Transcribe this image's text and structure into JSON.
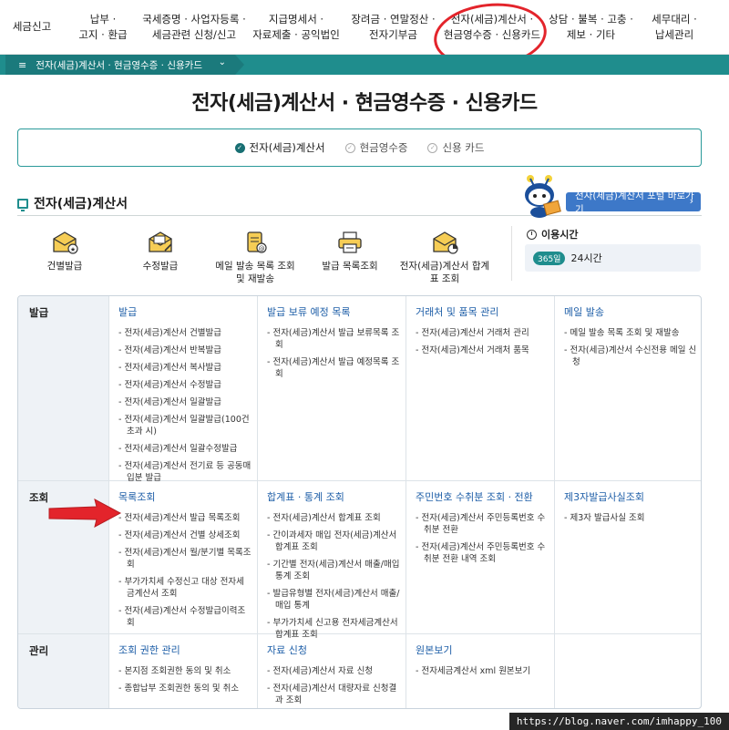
{
  "nav": {
    "items": [
      {
        "line1": "세금신고",
        "line2": ""
      },
      {
        "line1": "납부 ·",
        "line2": "고지 · 환급"
      },
      {
        "line1": "국세증명 · 사업자등록 ·",
        "line2": "세금관련 신청/신고"
      },
      {
        "line1": "지급명세서 ·",
        "line2": "자료제출 · 공익법인"
      },
      {
        "line1": "장려금 · 연말정산 ·",
        "line2": "전자기부금"
      },
      {
        "line1": "전자(세금)계산서 ·",
        "line2": "현금영수증 · 신용카드"
      },
      {
        "line1": "상담 · 불복 · 고충 ·",
        "line2": "제보 · 기타"
      },
      {
        "line1": "세무대리 ·",
        "line2": "납세관리"
      }
    ]
  },
  "breadcrumb": {
    "label": "전자(세금)계산서 · 현금영수증 · 신용카드"
  },
  "page_title": "전자(세금)계산서 · 현금영수증 · 신용카드",
  "tabs": [
    {
      "label": "전자(세금)계산서",
      "active": true
    },
    {
      "label": "현금영수증",
      "active": false
    },
    {
      "label": "신용 카드",
      "active": false
    }
  ],
  "section": {
    "title": "전자(세금)계산서",
    "portal_button": "전자(세금)계산서 포털 바로가기"
  },
  "quick_links": [
    {
      "label": "건별발급",
      "icon": "envelope-star-icon"
    },
    {
      "label": "수정발급",
      "icon": "envelope-edit-icon"
    },
    {
      "label": "메일 발송 목록 조회 및 재발송",
      "icon": "scroll-mail-icon"
    },
    {
      "label": "발급 목록조회",
      "icon": "printer-icon"
    },
    {
      "label": "전자(세금)계산서 합계표 조회",
      "icon": "envelope-chart-icon"
    }
  ],
  "usage": {
    "title": "이용시간",
    "badge": "365일",
    "hours": "24시간"
  },
  "table": {
    "rows": [
      {
        "head": "발급",
        "cells": [
          {
            "title": "발급",
            "items": [
              "전자(세금)계산서 건별발급",
              "전자(세금)계산서 반복발급",
              "전자(세금)계산서 복사발급",
              "전자(세금)계산서 수정발급",
              "전자(세금)계산서 일괄발급",
              "전자(세금)계산서 일괄발급(100건 초과 시)",
              "전자(세금)계산서 일괄수정발급",
              "전자(세금)계산서 전기료 등 공동매입분 발급"
            ]
          },
          {
            "title": "발급 보류 예정 목록",
            "items": [
              "전자(세금)계산서 발급 보류목록 조회",
              "전자(세금)계산서 발급 예정목록 조회"
            ]
          },
          {
            "title": "거래처 및 품목 관리",
            "items": [
              "전자(세금)계산서 거래처 관리",
              "전자(세금)계산서 거래처 품목"
            ]
          },
          {
            "title": "메일 발송",
            "items": [
              "메일 발송 목록 조회 및 재발송",
              "전자(세금)계산서 수신전용 메일 신청"
            ]
          }
        ]
      },
      {
        "head": "조회",
        "cells": [
          {
            "title": "목록조회",
            "items": [
              "전자(세금)계산서 발급 목록조회",
              "전자(세금)계산서 건별 상세조회",
              "전자(세금)계산서 월/분기별 목록조회",
              "부가가치세 수정신고 대상 전자세금계산서 조회",
              "전자(세금)계산서 수정발급이력조회"
            ]
          },
          {
            "title": "합계표 · 통계 조회",
            "items": [
              "전자(세금)계산서 합계표 조회",
              "간이과세자 매입 전자(세금)계산서 합계표 조회",
              "기간별 전자(세금)계산서 매출/매입 통계 조회",
              "발급유형별 전자(세금)계산서 매출/매입 통계",
              "부가가치세 신고용 전자세금계산서 합계표 조회"
            ]
          },
          {
            "title": "주민번호 수취분 조회 · 전환",
            "items": [
              "전자(세금)계산서 주민등록번호 수취분 전환",
              "전자(세금)계산서 주민등록번호 수취분 전환 내역 조회"
            ]
          },
          {
            "title": "제3자발급사실조회",
            "items": [
              "제3자 발급사실 조회"
            ]
          }
        ]
      },
      {
        "head": "관리",
        "cells": [
          {
            "title": "조회 권한 관리",
            "items": [
              "본지점 조회권한 동의 및 취소",
              "종합납부 조회권한 동의 및 취소"
            ]
          },
          {
            "title": "자료 신청",
            "items": [
              "전자(세금)계산서 자료 신청",
              "전자(세금)계산서 대량자료 신청결과 조회"
            ]
          },
          {
            "title": "원본보기",
            "items": [
              "전자세금계산서 xml 원본보기"
            ]
          },
          {
            "title": "",
            "items": []
          }
        ]
      }
    ]
  },
  "watermark": "https://blog.naver.com/imhappy_100",
  "colors": {
    "teal": "#1f8d8d",
    "link_blue": "#1f5fa8",
    "portal_blue": "#3d78c8",
    "red": "#e3242b"
  }
}
